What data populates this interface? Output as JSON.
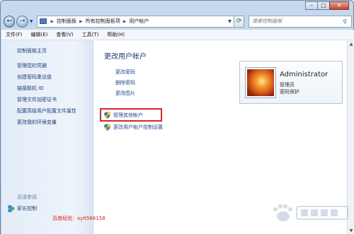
{
  "window": {
    "caption_buttons": {
      "minimize": "–",
      "maximize": "□",
      "close": "✕"
    }
  },
  "address_bar": {
    "crumbs": [
      "控制面板",
      "所有控制面板项",
      "用户帐户"
    ]
  },
  "search": {
    "placeholder": "搜索控制面板"
  },
  "menu": [
    "文件(F)",
    "编辑(E)",
    "查看(V)",
    "工具(T)",
    "帮助(H)"
  ],
  "sidebar": {
    "home": "控制面板主页",
    "links": [
      "管理您的凭据",
      "创建密码重设盘",
      "链接联机 ID",
      "管理文件加密证书",
      "配置高级用户配置文件属性",
      "更改我的环境变量"
    ],
    "see_also": "另请参阅",
    "family_safety": "家长控制"
  },
  "main": {
    "title": "更改用户帐户",
    "links": [
      "更改密码",
      "删除密码",
      "更改图片"
    ],
    "manage_other": "管理其他帐户",
    "uac_settings": "更改用户帐户控制设置"
  },
  "account": {
    "name": "Administrator",
    "role": "管理员",
    "password_status": "密码保护"
  },
  "watermark": "百度经验：xylt566158",
  "colors": {
    "highlight_box": "#d92626",
    "link": "#1d4a8a",
    "watermark": "#e01a1a"
  }
}
